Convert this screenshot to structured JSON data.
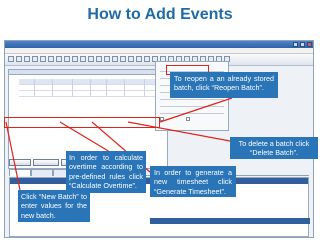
{
  "slide": {
    "title": "How to Add Events"
  },
  "callouts": {
    "reopen": "To reopen a an already stored batch, click “Reopen Batch”.",
    "delete": "To delete a batch click “Delete Batch”.",
    "overtime": "In order to calculate overtime according to pre-defined rules click “Calculate Overtime”.",
    "timesheet": "In order to generate a new timesheet click “Generate Timesheet”.",
    "newbatch": "Click “New Batch” to enter values for the new batch."
  },
  "colors": {
    "title": "#1f6aa8",
    "callout_bg": "#2a74b8",
    "callout_text": "#ffffff",
    "highlight": "#e0231b"
  }
}
